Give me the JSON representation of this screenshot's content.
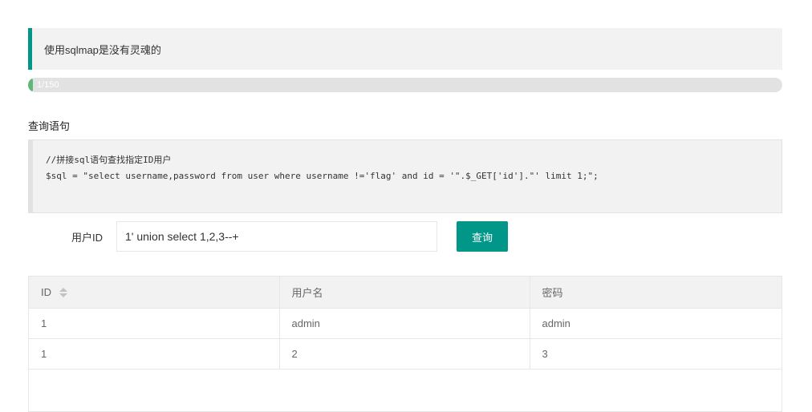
{
  "notice": {
    "text": "使用sqlmap是没有灵魂的"
  },
  "progress": {
    "text": "1/150",
    "value": 1,
    "max": 150
  },
  "query_section": {
    "title": "查询语句",
    "code_lines": [
      "//拼接sql语句查找指定ID用户",
      "$sql = \"select username,password from user where username !='flag' and id = '\".$_GET['id'].\"' limit 1;\";"
    ]
  },
  "form": {
    "label": "用户ID",
    "input_value": "1' union select 1,2,3--+",
    "button_label": "查询"
  },
  "table": {
    "headers": [
      "ID",
      "用户名",
      "密码"
    ],
    "rows": [
      [
        "1",
        "admin",
        "admin"
      ],
      [
        "1",
        "2",
        "3"
      ]
    ]
  },
  "colors": {
    "accent": "#009688",
    "progress": "#5FB878"
  }
}
